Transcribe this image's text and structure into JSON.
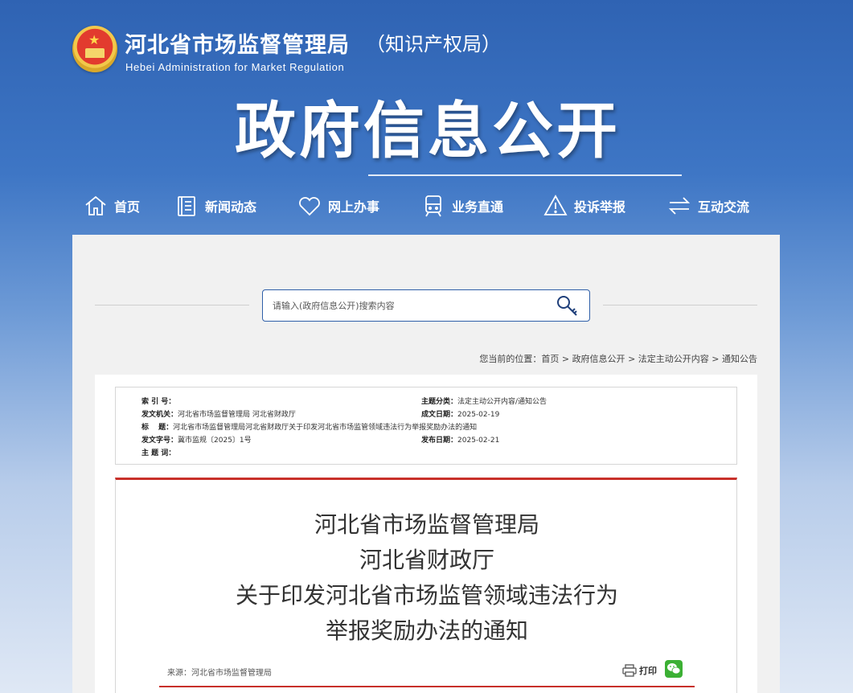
{
  "header": {
    "site_title": "河北省市场监督管理局",
    "site_suffix": "（知识产权局）",
    "site_english": "Hebei Administration for Market Regulation",
    "banner_title": "政府信息公开"
  },
  "nav": [
    {
      "label": "首页",
      "icon": "home-icon"
    },
    {
      "label": "新闻动态",
      "icon": "news-icon"
    },
    {
      "label": "网上办事",
      "icon": "heart-icon"
    },
    {
      "label": "业务直通",
      "icon": "train-icon"
    },
    {
      "label": "投诉举报",
      "icon": "warning-icon"
    },
    {
      "label": "互动交流",
      "icon": "exchange-icon"
    }
  ],
  "search": {
    "placeholder": "请输入(政府信息公开)搜索内容",
    "button_icon": "search-key-icon"
  },
  "breadcrumb": {
    "prefix": "您当前的位置：",
    "items": [
      "首页",
      "政府信息公开",
      "法定主动公开内容",
      "通知公告"
    ],
    "separator": ">"
  },
  "meta": {
    "index_label": "索 引 号：",
    "index_value": "",
    "subject_label": "主题分类：",
    "subject_value": "法定主动公开内容/通知公告",
    "issuer_label": "发文机关：",
    "issuer_value": "河北省市场监督管理局 河北省财政厅",
    "created_label": "成文日期：",
    "created_value": "2025-02-19",
    "title_label": "标　 题：",
    "title_value": "河北省市场监督管理局河北省财政厅关于印发河北省市场监管领域违法行为举报奖励办法的通知",
    "docno_label": "发文字号：",
    "docno_value": "冀市监规〔2025〕1号",
    "published_label": "发布日期：",
    "published_value": "2025-02-21",
    "keywords_label": "主 题 词：",
    "keywords_value": ""
  },
  "document": {
    "title_lines": [
      "河北省市场监督管理局",
      "河北省财政厅",
      "关于印发河北省市场监管领域违法行为",
      "举报奖励办法的通知"
    ],
    "source": "来源：河北省市场监督管理局",
    "print_label": "打印",
    "share_icon": "wechat-icon"
  },
  "colors": {
    "accent_blue": "#2f5fa8",
    "accent_red": "#c8302a",
    "wechat_green": "#3cb034"
  }
}
